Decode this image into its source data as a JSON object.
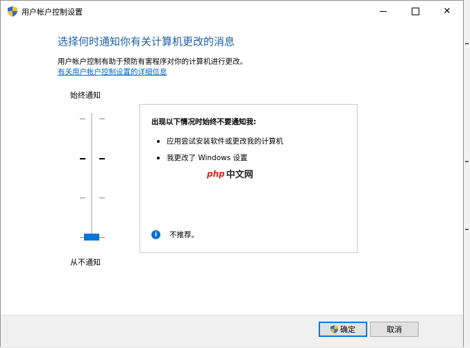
{
  "window": {
    "title": "用户帐户控制设置",
    "controls": {
      "minimize": "minimize",
      "maximize": "maximize",
      "close": "✕"
    }
  },
  "main": {
    "heading": "选择何时通知你有关计算机更改的消息",
    "description": "用户帐户控制有助于预防有害程序对你的计算机进行更改。",
    "link": "有关用户帐户控制设置的详细信息"
  },
  "slider": {
    "top_label": "始终通知",
    "bottom_label": "从不通知",
    "level_count": 4,
    "selected_level": 1
  },
  "info": {
    "title": "出现以下情况时始终不要通知我:",
    "bullets": [
      "应用尝试安装软件或更改我的计算机",
      "我更改了 Windows 设置"
    ],
    "note": "不推荐。",
    "watermark_php": "php",
    "watermark_cn": "中文网"
  },
  "footer": {
    "ok_label": "确定",
    "cancel_label": "取消"
  },
  "colors": {
    "accent": "#0a77d6",
    "heading": "#1c5fa7",
    "link": "#0066cc"
  },
  "icons": [
    "uac-shield-icon",
    "info-icon"
  ]
}
